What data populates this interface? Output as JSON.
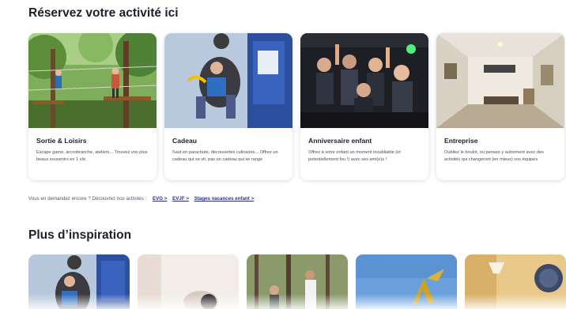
{
  "section1": {
    "title": "Réservez votre activité ici"
  },
  "cards": [
    {
      "title": "Sortie & Loisirs",
      "desc": "Escape game, accrobranche, ateliers... Trouvez vos plus beaux souvenirs en 1 clic",
      "image": "treetop-adventure-photo"
    },
    {
      "title": "Cadeau",
      "desc": "Saut en parachute, découvertes culinaires... Offrez un cadeau qui se vit, pas un cadeau qui se range",
      "image": "skydiving-photo"
    },
    {
      "title": "Anniversaire enfant",
      "desc": "Offrez à votre enfant un moment inoubliable (et potentiellement fou !) avec ses ami(e)s !",
      "image": "kids-laser-game-photo"
    },
    {
      "title": "Entreprise",
      "desc": "Oubliez le boulot, ou pensez-y autrement avec des activités qui changeront (en mieux) vos équipes",
      "image": "escape-room-photo"
    }
  ],
  "more": {
    "text": "Vous en demandez encore ? Découvrez nos activités :",
    "links": [
      "EVG >",
      "EVJF >",
      "Stages vacances enfant >"
    ]
  },
  "section2": {
    "title": "Plus d’inspiration"
  },
  "inspiration": [
    {
      "image": "skydiving-photo"
    },
    {
      "image": "blurred-interior-photo"
    },
    {
      "image": "forest-group-photo"
    },
    {
      "image": "golden-statue-sky-photo"
    },
    {
      "image": "lamp-interior-photo"
    }
  ],
  "colors": {
    "link": "#2c2f8f",
    "title": "#1e1e2d",
    "text": "#4a4a5a"
  }
}
